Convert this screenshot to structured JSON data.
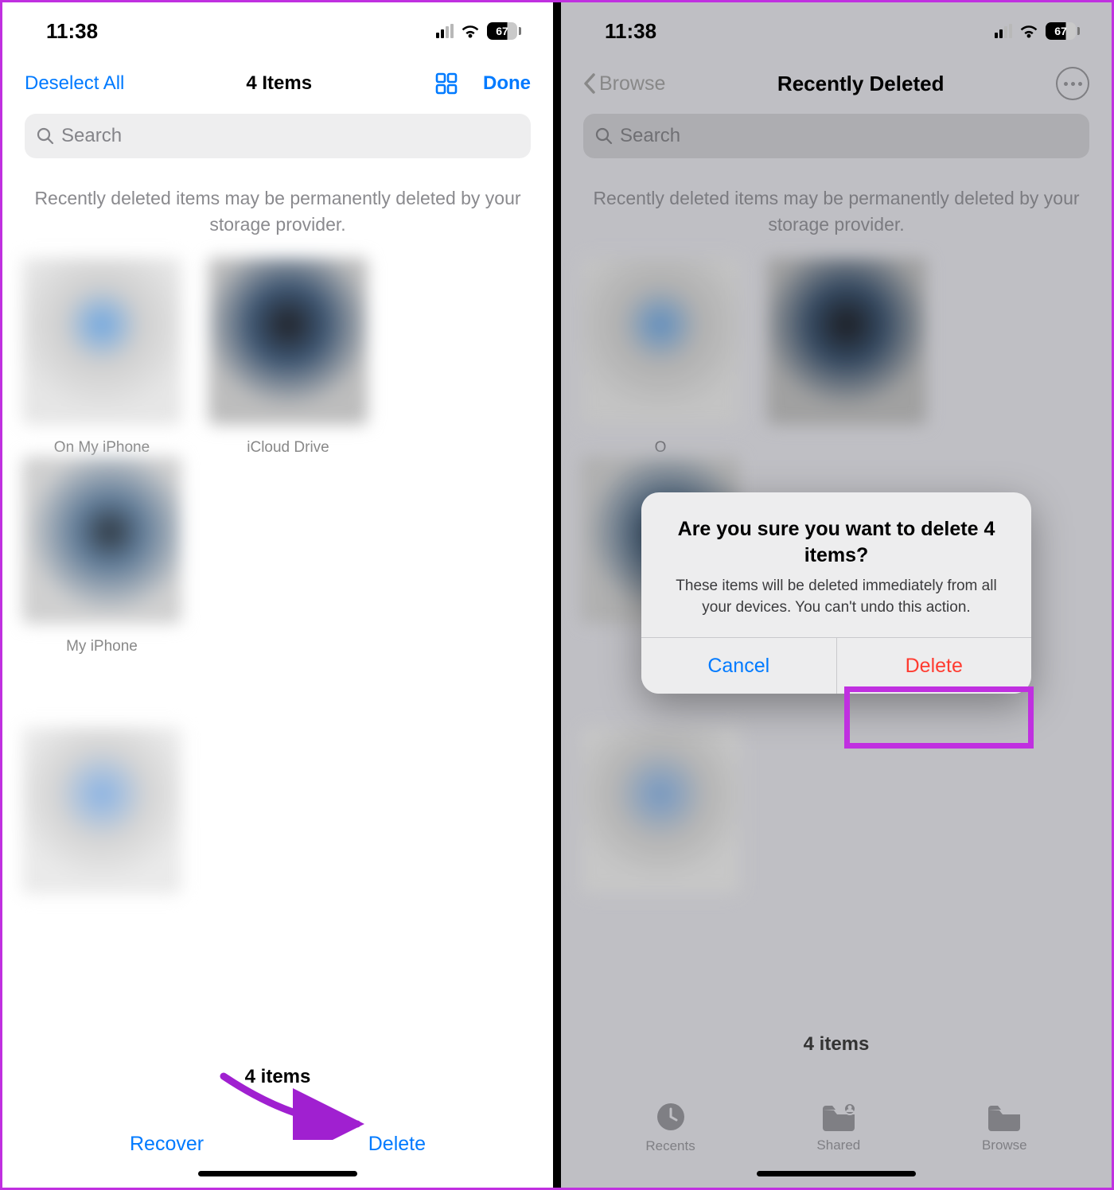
{
  "status": {
    "time": "11:38",
    "battery": "67"
  },
  "left": {
    "nav": {
      "deselect": "Deselect All",
      "title": "4 Items",
      "done": "Done"
    },
    "search": {
      "placeholder": "Search"
    },
    "notice": "Recently deleted items may be permanently deleted by your storage provider.",
    "items": [
      {
        "label": "On My iPhone"
      },
      {
        "label": "iCloud Drive"
      },
      {
        "label": "My iPhone"
      },
      {
        "label": ""
      }
    ],
    "count": "4 items",
    "actions": {
      "recover": "Recover",
      "delete": "Delete"
    }
  },
  "right": {
    "nav": {
      "back": "Browse",
      "title": "Recently Deleted"
    },
    "search": {
      "placeholder": "Search"
    },
    "notice": "Recently deleted items may be permanently deleted by your storage provider.",
    "count": "4 items",
    "tabs": {
      "recents": "Recents",
      "shared": "Shared",
      "browse": "Browse"
    },
    "dialog": {
      "title": "Are you sure you want to delete 4 items?",
      "message": "These items will be deleted immediately from all your devices. You can't undo this action.",
      "cancel": "Cancel",
      "delete": "Delete"
    }
  }
}
